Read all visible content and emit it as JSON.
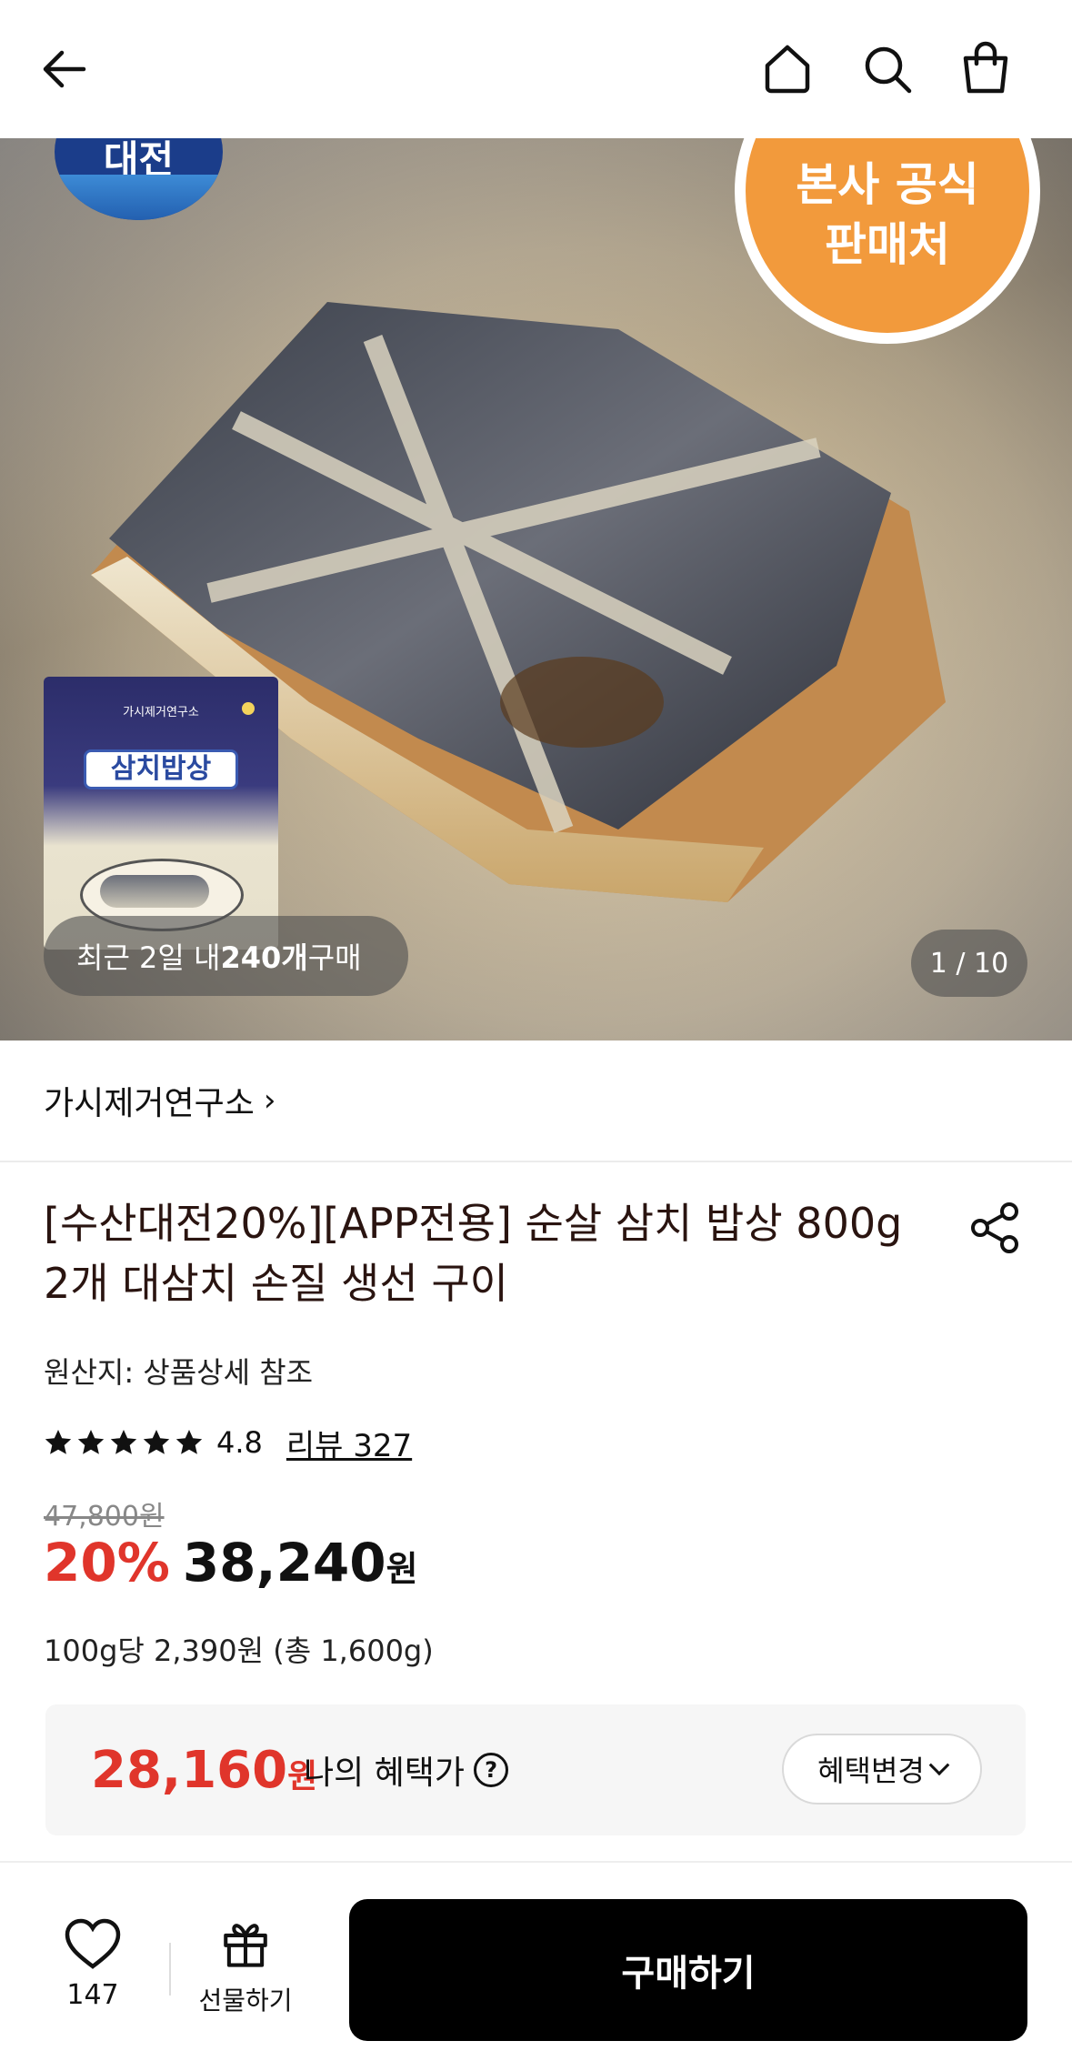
{
  "header": {
    "back_icon": "arrow-left-icon",
    "home_icon": "home-icon",
    "search_icon": "search-icon",
    "cart_icon": "shopping-bag-icon"
  },
  "hero": {
    "official_badge_line1": "본사 공식",
    "official_badge_line2": "판매처",
    "brand_mark_text": "대전",
    "pack_brand": "가시제거연구소",
    "pack_title": "삼치밥상",
    "recent_prefix": "최근 2일 내 ",
    "recent_count": "240개",
    "recent_suffix": " 구매",
    "image_counter": "1 / 10"
  },
  "store": {
    "name": "가시제거연구소",
    "chevron": "›"
  },
  "product": {
    "title": "[수산대전20%][APP전용] 순살 삼치 밥상 800g 2개 대삼치 손질 생선 구이",
    "origin": "원산지: 상품상세 참조",
    "rating": "4.8",
    "review_link": "리뷰 327",
    "original_price": "47,800원",
    "discount": "20%",
    "price": "38,240",
    "price_unit": "원",
    "unit_price": "100g당 2,390원 (총 1,600g)"
  },
  "benefit": {
    "price": "28,160",
    "price_unit": "원",
    "label": "나의 혜택가",
    "help": "?",
    "change_button": "혜택변경"
  },
  "bottom": {
    "like_count": "147",
    "gift_label": "선물하기",
    "buy_button": "구매하기"
  },
  "colors": {
    "accent_red": "#e0352b",
    "badge_orange": "#f29a3c",
    "buy_button_bg": "#000000"
  }
}
